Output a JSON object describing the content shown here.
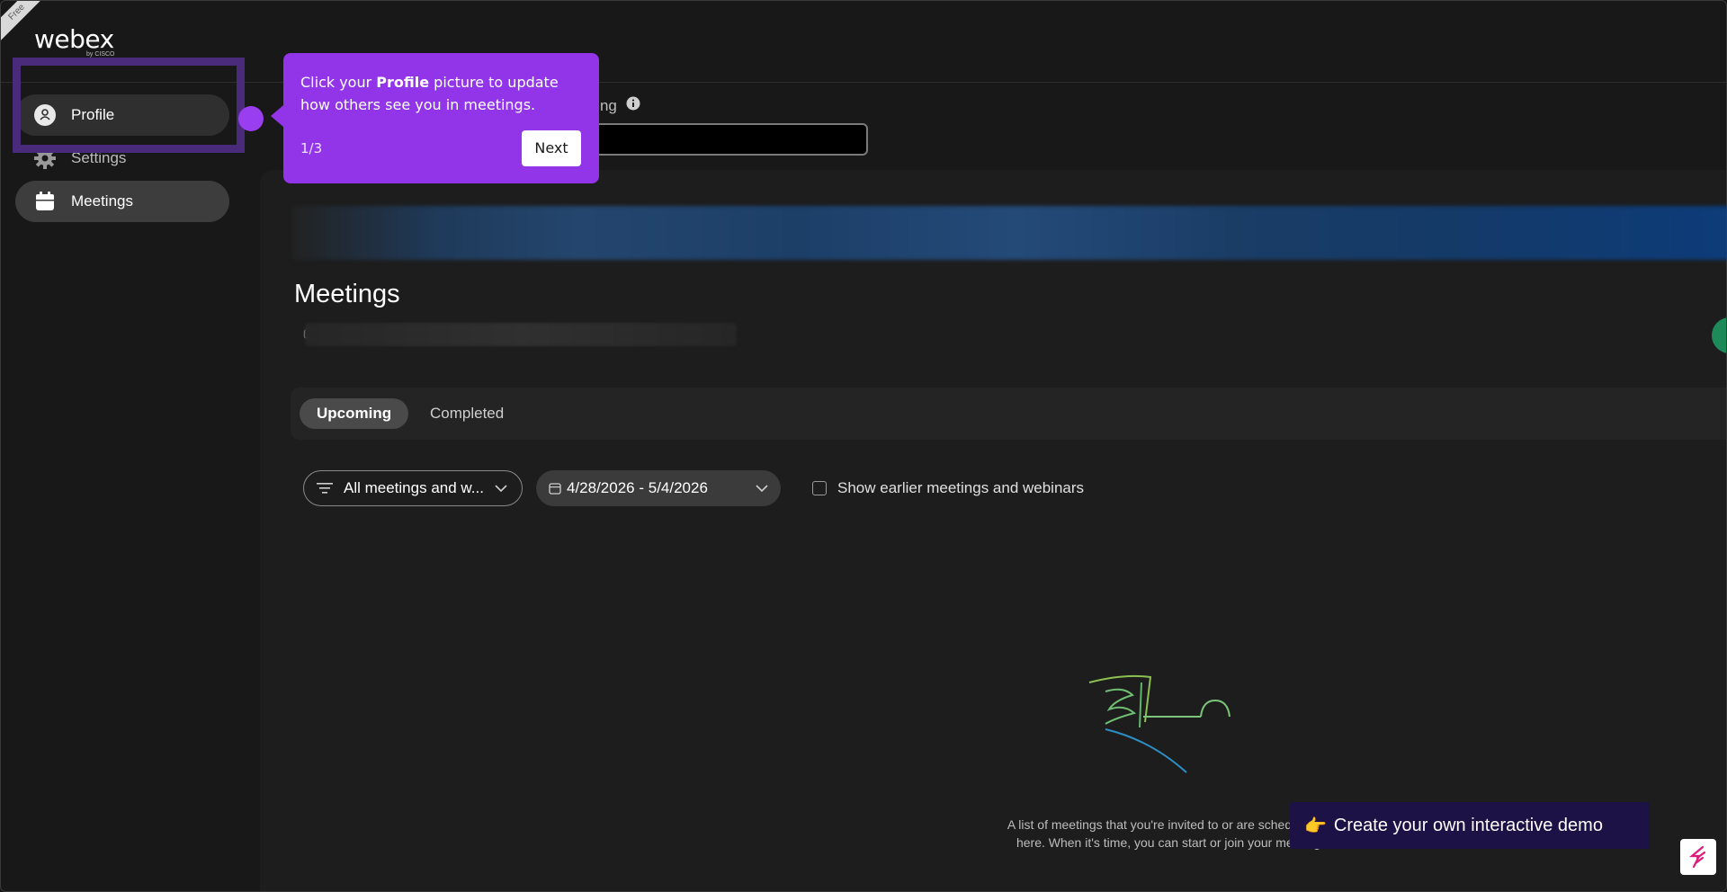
{
  "app": {
    "ribbon": "Free",
    "logo_word": "webex",
    "logo_by": "by CISCO"
  },
  "sidebar": {
    "items": [
      {
        "label": "Profile",
        "icon": "user-icon"
      },
      {
        "label": "Settings",
        "icon": "gear-icon"
      },
      {
        "label": "Meetings",
        "icon": "calendar-icon"
      }
    ]
  },
  "join": {
    "label": "eting"
  },
  "main": {
    "title": "Meetings",
    "tabs": [
      {
        "label": "Upcoming",
        "selected": true
      },
      {
        "label": "Completed",
        "selected": false
      }
    ],
    "filter": {
      "label": "All meetings and w..."
    },
    "date_range": {
      "label": "4/28/2026 - 5/4/2026"
    },
    "show_earlier": {
      "label": "Show earlier meetings and webinars"
    },
    "empty_text_line1": "A list of meetings that you're invited to or are scheduled to",
    "empty_text_line2": "here. When it's time, you can start or join your meeting"
  },
  "tooltip": {
    "text_before": "Click your ",
    "text_bold": "Profile",
    "text_after": " picture to update how others see you in meetings.",
    "step": "1/3",
    "next_label": "Next"
  },
  "cta": {
    "emoji": "👉",
    "label": "Create your own interactive demo"
  },
  "colors": {
    "accent": "#9234e8",
    "cta_bg": "#1c1245",
    "background": "#181818"
  }
}
